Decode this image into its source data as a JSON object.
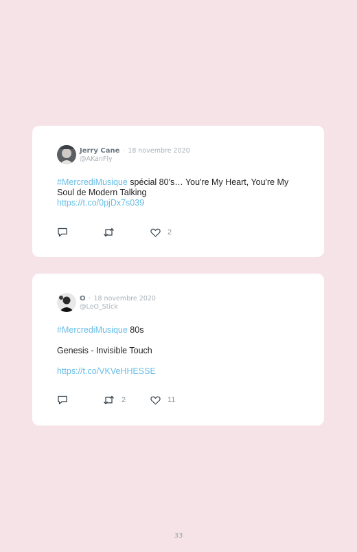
{
  "tweets": [
    {
      "name": "Jerry Cane",
      "separator": "·",
      "date": "18 novembre 2020",
      "handle": "@AKanFly",
      "hashtag": "#MercrediMusique",
      "text": " spécial 80's… You're My Heart, You're My Soul de Modern Talking",
      "link": "https://t.co/0pjDx7s039",
      "replies": "",
      "retweets": "",
      "likes": "2"
    },
    {
      "name": "O",
      "separator": "·",
      "date": "18 novembre 2020",
      "handle": "@LoO_Stick",
      "hashtag": "#MercrediMusique",
      "text": " 80s",
      "line2": "Genesis - Invisible Touch",
      "link": "https://t.co/VKVeHHESSE",
      "replies": "",
      "retweets": "2",
      "likes": "11"
    }
  ],
  "icons": {
    "reply": "reply-icon",
    "retweet": "retweet-icon",
    "like": "heart-icon",
    "avatar": "avatar"
  },
  "colors": {
    "page_background": "#f5e3e8",
    "card_background": "#ffffff",
    "link": "#66bde6",
    "muted": "#a8b2ba"
  },
  "page_number": "33"
}
